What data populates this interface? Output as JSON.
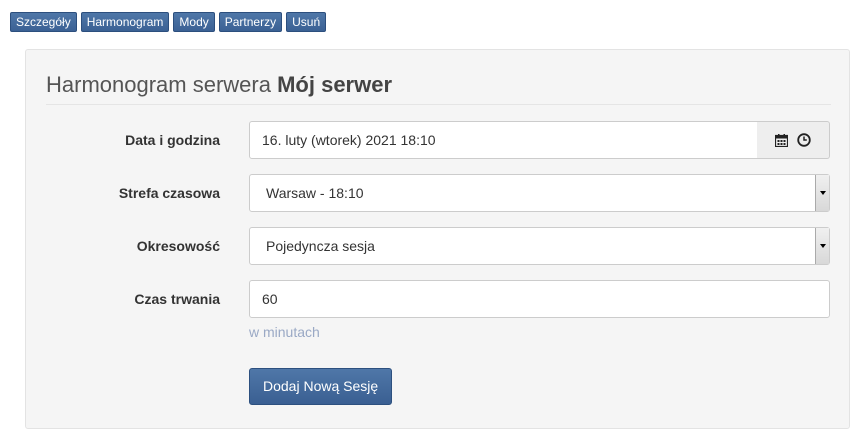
{
  "tabs": [
    {
      "label": "Szczegóły"
    },
    {
      "label": "Harmonogram"
    },
    {
      "label": "Mody"
    },
    {
      "label": "Partnerzy"
    },
    {
      "label": "Usuń"
    }
  ],
  "panel": {
    "title_prefix": "Harmonogram serwera",
    "server_name": "Mój serwer"
  },
  "form": {
    "datetime": {
      "label": "Data i godzina",
      "value": "16. luty (wtorek) 2021 18:10"
    },
    "timezone": {
      "label": "Strefa czasowa",
      "value": "Warsaw - 18:10"
    },
    "recurrence": {
      "label": "Okresowość",
      "value": "Pojedyncza sesja"
    },
    "duration": {
      "label": "Czas trwania",
      "value": "60",
      "hint": "w minutach"
    },
    "submit_label": "Dodaj Nową Sesję"
  },
  "icons": {
    "calendar": "calendar-icon",
    "clock": "clock-icon"
  }
}
